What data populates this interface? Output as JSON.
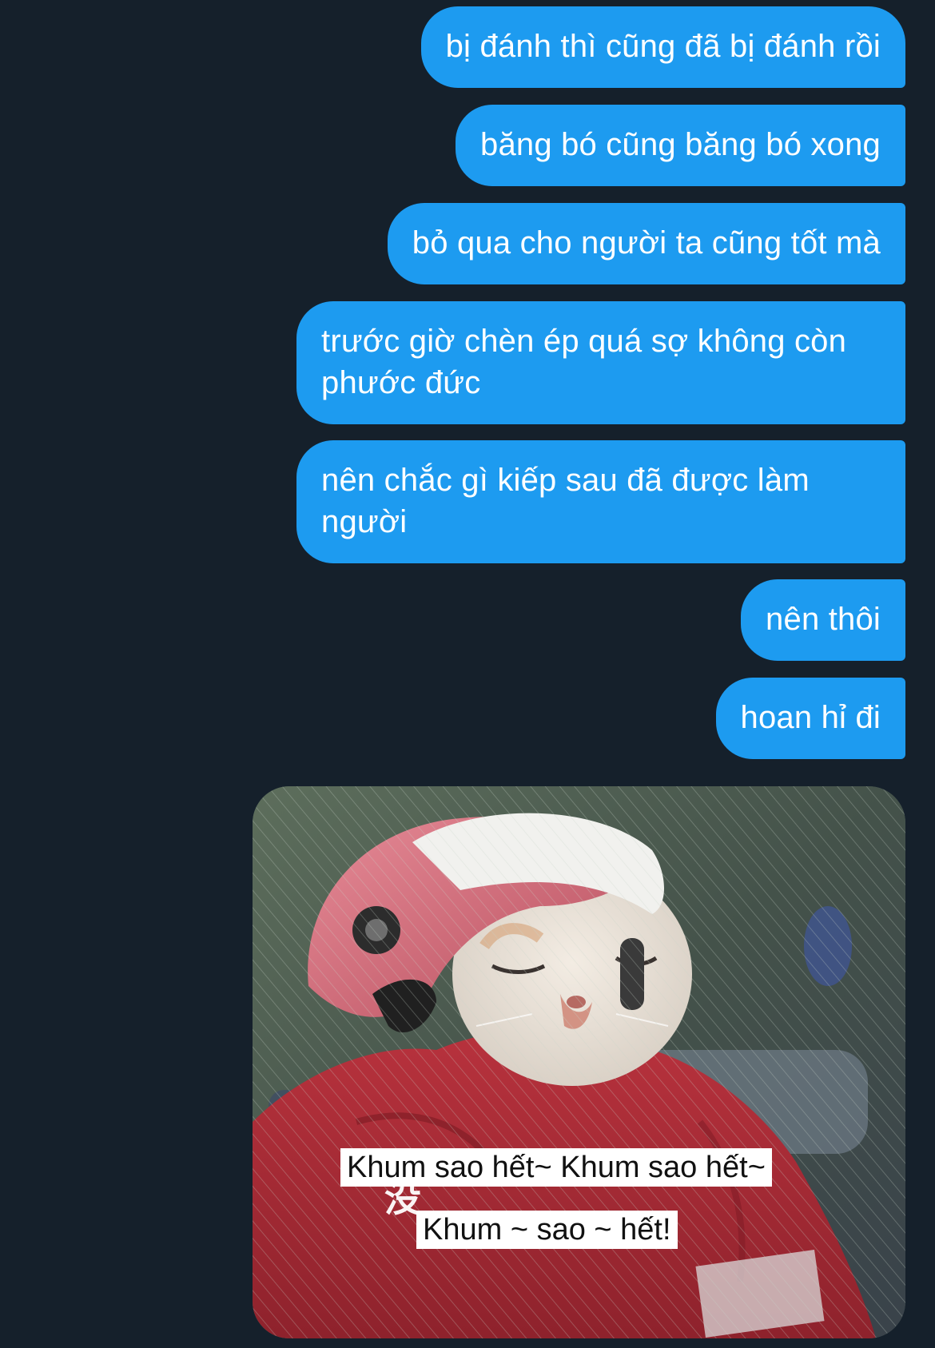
{
  "messages": [
    {
      "text": "bị đánh thì cũng đã bị đánh rồi"
    },
    {
      "text": "băng bó cũng băng bó xong"
    },
    {
      "text": "bỏ qua cho người ta cũng tốt mà"
    },
    {
      "text": "trước giờ chèn ép quá sợ không còn phước đức"
    },
    {
      "text": "nên chắc gì kiếp sau đã được làm người"
    },
    {
      "text": "nên thôi"
    },
    {
      "text": "hoan hỉ đi"
    }
  ],
  "meme": {
    "icon": "cat-helmet-meme-image",
    "caption_line1": "Khum sao hết~ Khum sao hết~",
    "caption_line2": "Khum ~ sao ~ hết!",
    "glyph": "没"
  },
  "colors": {
    "background": "#15202b",
    "bubble": "#1d9bf0",
    "bubble_text": "#ffffff"
  }
}
